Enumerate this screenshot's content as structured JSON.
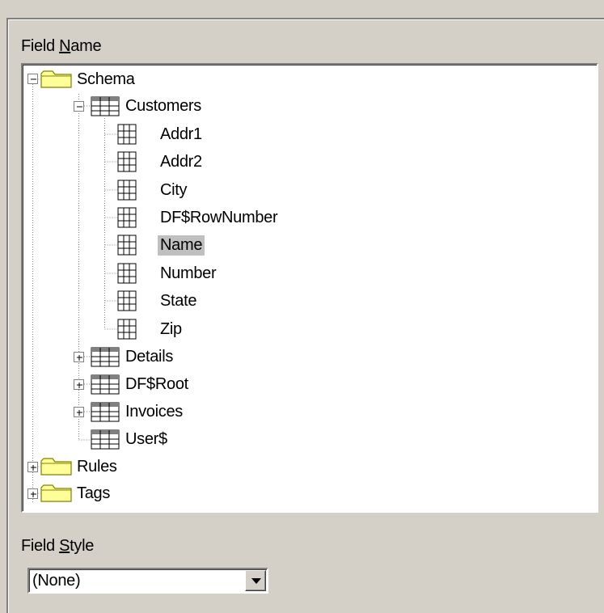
{
  "field_name_label": {
    "before": "Field ",
    "accel": "N",
    "after": "ame"
  },
  "field_style_label": {
    "before": "Field ",
    "accel": "S",
    "after": "tyle"
  },
  "tree": {
    "root": {
      "label": "Schema",
      "icon": "folder-icon",
      "expanded": true
    },
    "customers": {
      "label": "Customers",
      "icon": "table-icon",
      "expanded": true
    },
    "fields": [
      "Addr1",
      "Addr2",
      "City",
      "DF$RowNumber",
      "Name",
      "Number",
      "State",
      "Zip"
    ],
    "selected_field": "Name",
    "tables": [
      {
        "label": "Details",
        "expandable": true
      },
      {
        "label": "DF$Root",
        "expandable": true
      },
      {
        "label": "Invoices",
        "expandable": true
      },
      {
        "label": "User$",
        "expandable": false
      }
    ],
    "folders": [
      "Rules",
      "Tags"
    ]
  },
  "field_style": {
    "value": "(None)",
    "icon": "dropdown-arrow-icon"
  },
  "colors": {
    "background": "#d4d0c8",
    "selection": "#c0c0c0",
    "folder": "#ffff99",
    "border_dark": "#808080"
  }
}
